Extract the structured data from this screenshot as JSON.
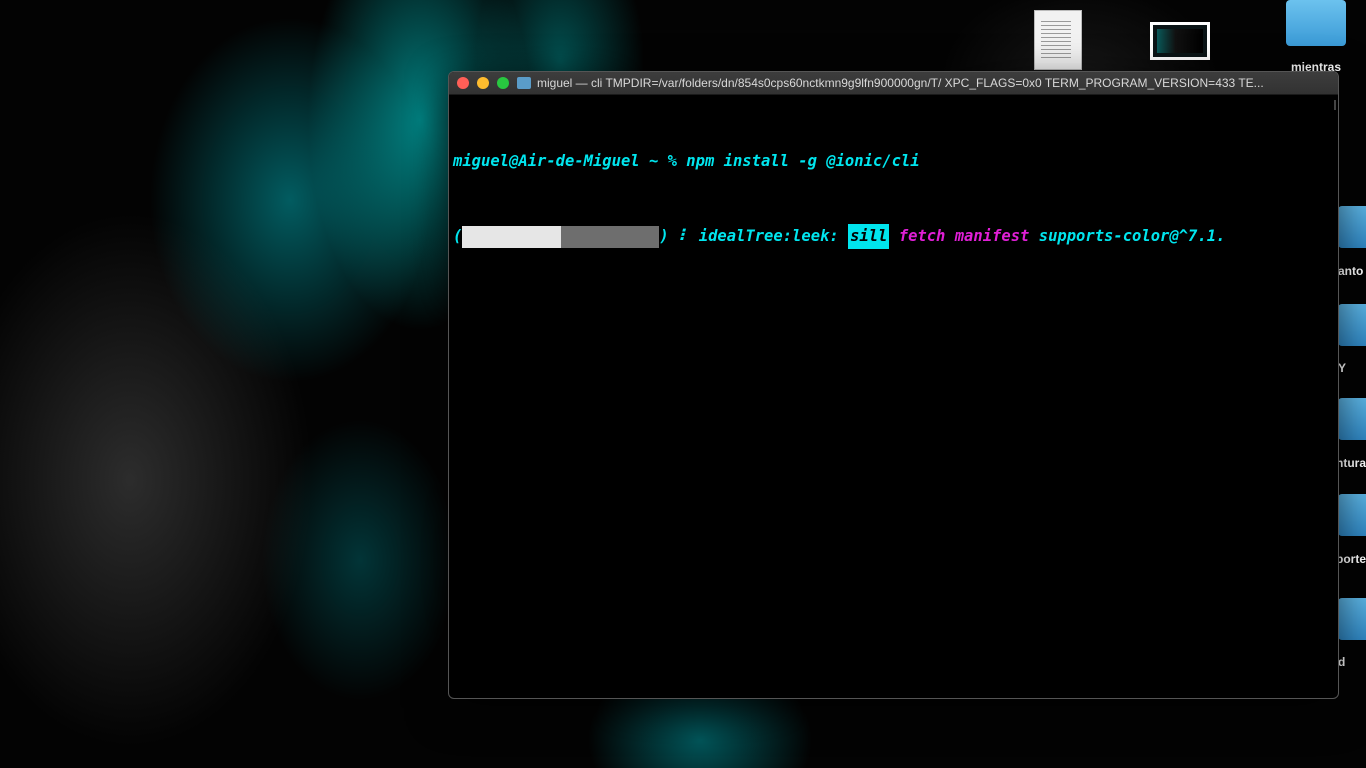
{
  "desktop": {
    "top_folder_label": "mientras",
    "side_folders": [
      {
        "label": "anto"
      },
      {
        "label": "Y"
      },
      {
        "label": "ntura"
      },
      {
        "label": "porte"
      },
      {
        "label": "d"
      }
    ]
  },
  "terminal": {
    "title": "miguel — cli TMPDIR=/var/folders/dn/854s0cps60nctkmn9g9lfn900000gn/T/ XPC_FLAGS=0x0 TERM_PROGRAM_VERSION=433 TE...",
    "prompt": "miguel@Air-de-Miguel ~ % ",
    "command": "npm install -g @ionic/cli",
    "progress": {
      "open_paren": "(",
      "close_paren": ")",
      "fraction": 0.5,
      "spinner": "⠇",
      "stage": "idealTree:leek:",
      "level": "sill",
      "action": "fetch manifest",
      "package": "supports-color@^7.1."
    }
  },
  "colors": {
    "cyan": "#00e5ee",
    "magenta": "#e01fd6",
    "bar_fill": "#e6e6e6",
    "bar_empty": "#6e6e6e"
  }
}
